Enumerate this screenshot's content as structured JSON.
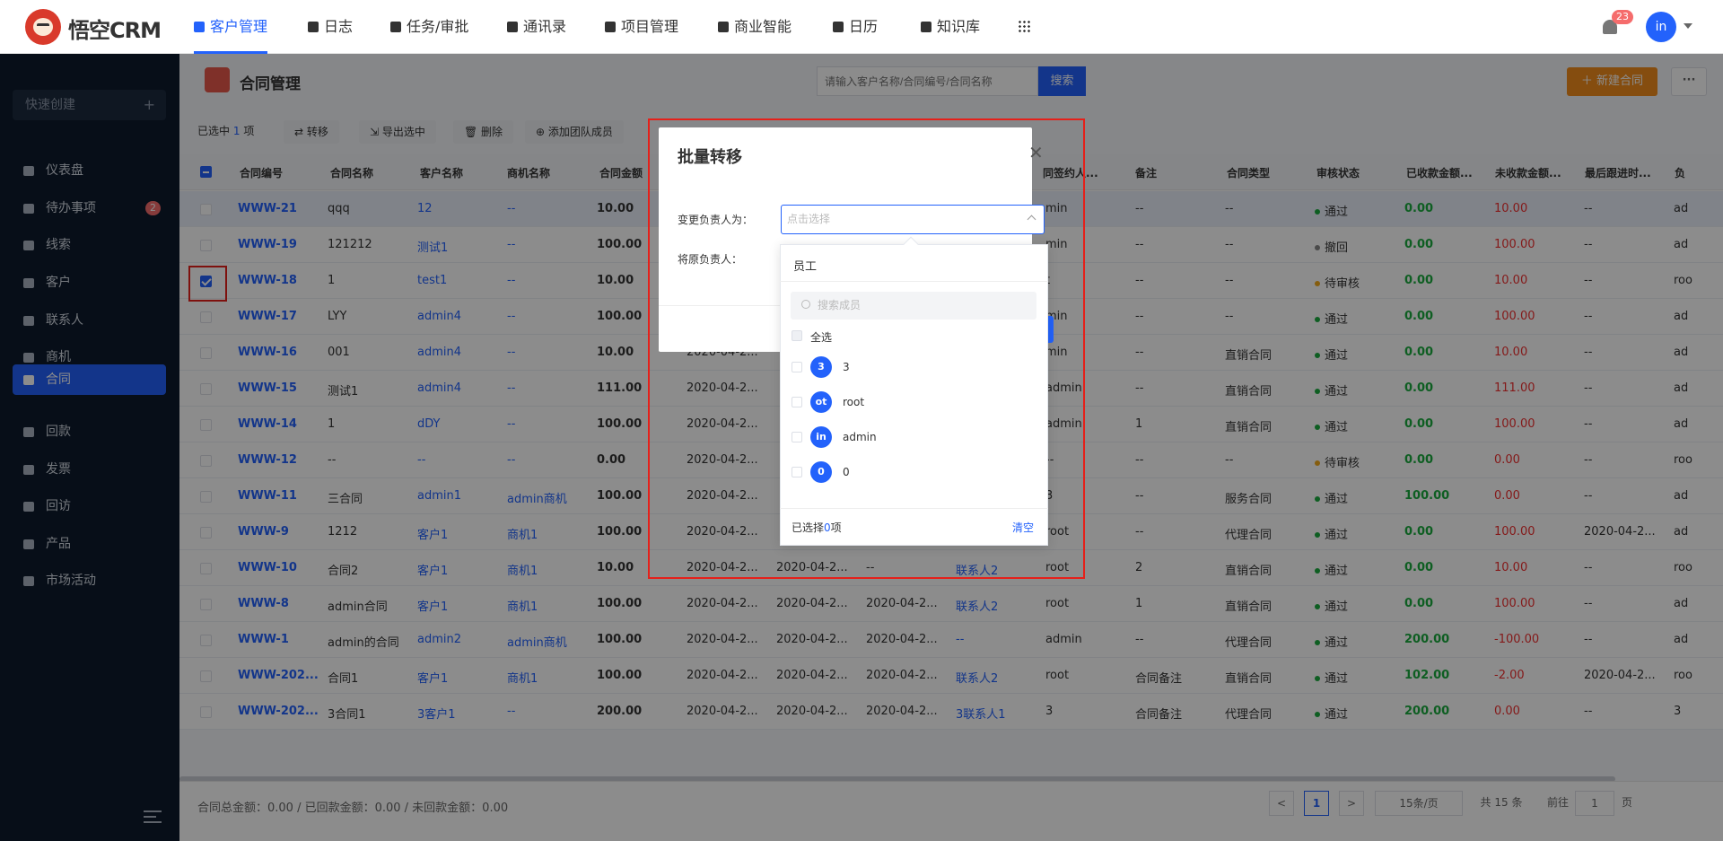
{
  "brand": "悟空CRM",
  "nav": [
    {
      "label": "客户管理",
      "active": true
    },
    {
      "label": "日志"
    },
    {
      "label": "任务/审批"
    },
    {
      "label": "通讯录"
    },
    {
      "label": "项目管理"
    },
    {
      "label": "商业智能"
    },
    {
      "label": "日历"
    },
    {
      "label": "知识库"
    }
  ],
  "notifications": "23",
  "user_initials": "in",
  "sidebar": {
    "quick_create": "快速创建",
    "quick_plus": "+",
    "items": [
      {
        "label": "仪表盘"
      },
      {
        "label": "待办事项",
        "badge": "2"
      },
      {
        "label": "线索"
      },
      {
        "label": "客户"
      },
      {
        "label": "联系人"
      },
      {
        "label": "商机"
      },
      {
        "label": "合同",
        "active": true
      },
      {
        "label": "回款"
      },
      {
        "label": "发票"
      },
      {
        "label": "回访"
      },
      {
        "label": "产品"
      },
      {
        "label": "市场活动"
      }
    ]
  },
  "page": {
    "title": "合同管理",
    "search_placeholder": "请输入客户名称/合同编号/合同名称",
    "search_button": "搜索",
    "new_button": "＋ 新建合同",
    "more_button": "···"
  },
  "toolbar": {
    "selected_prefix": "已选中",
    "selected_count": "1",
    "selected_suffix": "项",
    "buttons": [
      "⇄ 转移",
      "⇲ 导出选中",
      "🗑 删除",
      "⊕ 添加团队成员"
    ]
  },
  "table": {
    "headers": [
      "合同编号",
      "合同名称",
      "客户名称",
      "商机名称",
      "合同金额",
      "",
      "",
      "",
      "",
      "同签约人...",
      "备注",
      "合同类型",
      "审核状态",
      "已收款金额...",
      "未收款金额...",
      "最后跟进时...",
      "负"
    ],
    "rows": [
      {
        "no": "WWW-21",
        "name": "qqq",
        "customer": "12",
        "opp": "--",
        "amount": "10.00",
        "c5": "",
        "c6": "",
        "c7": "",
        "c8": "",
        "signer": "min",
        "remark": "--",
        "type": "--",
        "status": "通过",
        "received": "0.00",
        "unreceived": "10.00",
        "last": "--",
        "owner": "ad"
      },
      {
        "no": "WWW-19",
        "name": "121212",
        "customer": "测试1",
        "opp": "--",
        "amount": "100.00",
        "c5": "",
        "c6": "",
        "c7": "",
        "c8": "",
        "signer": "min",
        "remark": "--",
        "type": "--",
        "status": "撤回",
        "received": "0.00",
        "unreceived": "100.00",
        "last": "--",
        "owner": "ad"
      },
      {
        "no": "WWW-18",
        "name": "1",
        "customer": "test1",
        "opp": "--",
        "amount": "10.00",
        "c5": "",
        "c6": "",
        "c7": "",
        "c8": "",
        "signer": "t",
        "remark": "--",
        "type": "--",
        "status": "待审核",
        "received": "0.00",
        "unreceived": "10.00",
        "last": "--",
        "owner": "roo"
      },
      {
        "no": "WWW-17",
        "name": "LYY",
        "customer": "admin4",
        "opp": "--",
        "amount": "100.00",
        "c5": "",
        "c6": "",
        "c7": "",
        "c8": "",
        "signer": "min",
        "remark": "--",
        "type": "--",
        "status": "通过",
        "received": "0.00",
        "unreceived": "100.00",
        "last": "--",
        "owner": "ad"
      },
      {
        "no": "WWW-16",
        "name": "001",
        "customer": "admin4",
        "opp": "--",
        "amount": "10.00",
        "c5": "2020-04-2...",
        "c6": "",
        "c7": "",
        "c8": "",
        "signer": "min",
        "remark": "--",
        "type": "直销合同",
        "status": "通过",
        "received": "0.00",
        "unreceived": "10.00",
        "last": "--",
        "owner": "ad"
      },
      {
        "no": "WWW-15",
        "name": "测试1",
        "customer": "admin4",
        "opp": "--",
        "amount": "111.00",
        "c5": "2020-04-2...",
        "c6": "",
        "c7": "",
        "c8": "",
        "signer": "admin",
        "remark": "--",
        "type": "直销合同",
        "status": "通过",
        "received": "0.00",
        "unreceived": "111.00",
        "last": "--",
        "owner": "ad"
      },
      {
        "no": "WWW-14",
        "name": "1",
        "customer": "dDY",
        "opp": "--",
        "amount": "100.00",
        "c5": "2020-04-2...",
        "c6": "",
        "c7": "",
        "c8": "",
        "signer": "admin",
        "remark": "1",
        "type": "直销合同",
        "status": "通过",
        "received": "0.00",
        "unreceived": "100.00",
        "last": "--",
        "owner": "ad"
      },
      {
        "no": "WWW-12",
        "name": "--",
        "customer": "--",
        "opp": "--",
        "amount": "0.00",
        "c5": "2020-04-2...",
        "c6": "",
        "c7": "",
        "c8": "",
        "signer": "--",
        "remark": "--",
        "type": "--",
        "status": "待审核",
        "received": "0.00",
        "unreceived": "0.00",
        "last": "--",
        "owner": "roo"
      },
      {
        "no": "WWW-11",
        "name": "三合同",
        "customer": "admin1",
        "opp": "admin商机",
        "amount": "100.00",
        "c5": "2020-04-2...",
        "c6": "",
        "c7": "",
        "c8": "",
        "signer": "3",
        "remark": "--",
        "type": "服务合同",
        "status": "通过",
        "received": "100.00",
        "unreceived": "0.00",
        "last": "--",
        "owner": "ad"
      },
      {
        "no": "WWW-9",
        "name": "1212",
        "customer": "客户1",
        "opp": "商机1",
        "amount": "100.00",
        "c5": "2020-04-2...",
        "c6": "",
        "c7": "",
        "c8": "",
        "signer": "root",
        "remark": "--",
        "type": "代理合同",
        "status": "通过",
        "received": "0.00",
        "unreceived": "100.00",
        "last": "2020-04-2...",
        "owner": "ad"
      },
      {
        "no": "WWW-10",
        "name": "合同2",
        "customer": "客户1",
        "opp": "商机1",
        "amount": "10.00",
        "c5": "2020-04-2...",
        "c6": "2020-04-2...",
        "c7": "--",
        "c8": "联系人2",
        "signer": "root",
        "remark": "2",
        "type": "直销合同",
        "status": "通过",
        "received": "0.00",
        "unreceived": "10.00",
        "last": "--",
        "owner": "roo"
      },
      {
        "no": "WWW-8",
        "name": "admin合同",
        "customer": "客户1",
        "opp": "商机1",
        "amount": "100.00",
        "c5": "2020-04-2...",
        "c6": "2020-04-2...",
        "c7": "2020-04-2...",
        "c8": "联系人2",
        "signer": "root",
        "remark": "1",
        "type": "直销合同",
        "status": "通过",
        "received": "0.00",
        "unreceived": "100.00",
        "last": "--",
        "owner": "ad"
      },
      {
        "no": "WWW-1",
        "name": "admin的合同",
        "customer": "admin2",
        "opp": "admin商机",
        "amount": "100.00",
        "c5": "2020-04-2...",
        "c6": "2020-04-2...",
        "c7": "2020-04-2...",
        "c8": "--",
        "signer": "admin",
        "remark": "--",
        "type": "代理合同",
        "status": "通过",
        "received": "200.00",
        "unreceived": "-100.00",
        "last": "--",
        "owner": "ad"
      },
      {
        "no": "WWW-202...",
        "name": "合同1",
        "customer": "客户1",
        "opp": "商机1",
        "amount": "100.00",
        "c5": "2020-04-2...",
        "c6": "2020-04-2...",
        "c7": "2020-04-2...",
        "c8": "联系人2",
        "signer": "root",
        "remark": "合同备注",
        "type": "直销合同",
        "status": "通过",
        "received": "102.00",
        "unreceived": "-2.00",
        "last": "2020-04-2...",
        "owner": "roo"
      },
      {
        "no": "WWW-202...",
        "name": "3合同1",
        "customer": "3客户1",
        "opp": "--",
        "amount": "200.00",
        "c5": "2020-04-2...",
        "c6": "2020-04-2...",
        "c7": "2020-04-2...",
        "c8": "3联系人1",
        "signer": "3",
        "remark": "合同备注",
        "type": "代理合同",
        "status": "通过",
        "received": "200.00",
        "unreceived": "0.00",
        "last": "--",
        "owner": "3"
      }
    ]
  },
  "footer": {
    "totals": "合同总金额：0.00 / 已回款金额：0.00 / 未回款金额：0.00",
    "prev": "<",
    "page": "1",
    "next": ">",
    "page_size": "15条/页",
    "total": "共 15 条",
    "goto_label": "前往",
    "goto_value": "1",
    "goto_suffix": "页"
  },
  "dialog": {
    "title": "批量转移",
    "close": "✕",
    "field_new_owner": "变更负责人为：",
    "field_old_owner": "将原负责人：",
    "select_placeholder": "点击选择"
  },
  "member_picker": {
    "tab": "员工",
    "search_placeholder": "搜索成员",
    "select_all": "全选",
    "members": [
      {
        "avatar": "3",
        "name": "3"
      },
      {
        "avatar": "ot",
        "name": "root"
      },
      {
        "avatar": "in",
        "name": "admin"
      },
      {
        "avatar": "0",
        "name": "0"
      }
    ],
    "selected_prefix": "已选择",
    "selected_count": "0",
    "selected_suffix": "项",
    "clear": "清空"
  },
  "colors": {
    "accent": "#2362fb",
    "warning": "#f28d1c",
    "danger": "#f13030",
    "success": "#1bac3e",
    "sidebar": "#0d1a2c"
  }
}
